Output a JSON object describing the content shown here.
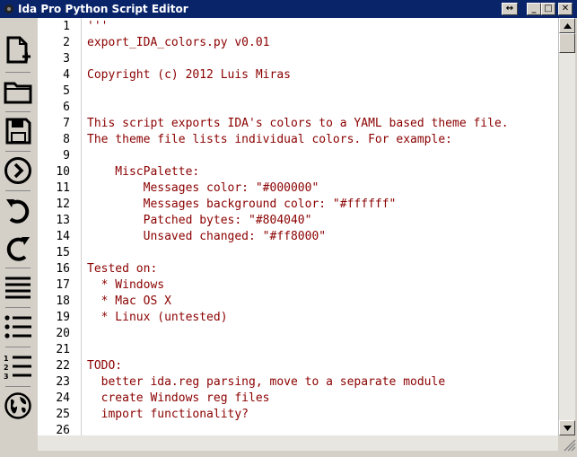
{
  "window": {
    "title": "Ida Pro Python Script Editor"
  },
  "title_buttons": [
    {
      "name": "resize-arrows-button",
      "glyph": "↔"
    },
    {
      "name": "minimize-button",
      "glyph": "_"
    },
    {
      "name": "maximize-button",
      "glyph": "□"
    },
    {
      "name": "close-button",
      "glyph": "✕"
    }
  ],
  "toolbar": {
    "tools": [
      {
        "name": "new-file-button",
        "icon": "new-file-icon"
      },
      {
        "name": "open-folder-button",
        "icon": "folder-icon"
      },
      {
        "name": "save-button",
        "icon": "save-icon"
      },
      {
        "name": "run-button",
        "icon": "run-circle-chevron-icon"
      },
      {
        "name": "undo-button",
        "icon": "undo-icon"
      },
      {
        "name": "redo-button",
        "icon": "redo-icon"
      },
      {
        "name": "align-button",
        "icon": "align-lines-icon"
      },
      {
        "name": "bullet-list-button",
        "icon": "bullet-list-icon"
      },
      {
        "name": "numbered-list-button",
        "icon": "numbered-list-icon"
      },
      {
        "name": "globe-button",
        "icon": "globe-icon"
      }
    ]
  },
  "editor": {
    "lines": [
      {
        "n": "1",
        "text": "'''"
      },
      {
        "n": "2",
        "text": "export_IDA_colors.py v0.01"
      },
      {
        "n": "3",
        "text": ""
      },
      {
        "n": "4",
        "text": "Copyright (c) 2012 Luis Miras"
      },
      {
        "n": "5",
        "text": ""
      },
      {
        "n": "6",
        "text": ""
      },
      {
        "n": "7",
        "text": "This script exports IDA's colors to a YAML based theme file."
      },
      {
        "n": "8",
        "text": "The theme file lists individual colors. For example:"
      },
      {
        "n": "9",
        "text": ""
      },
      {
        "n": "10",
        "text": "    MiscPalette:"
      },
      {
        "n": "11",
        "text": "        Messages color: \"#000000\""
      },
      {
        "n": "12",
        "text": "        Messages background color: \"#ffffff\""
      },
      {
        "n": "13",
        "text": "        Patched bytes: \"#804040\""
      },
      {
        "n": "14",
        "text": "        Unsaved changed: \"#ff8000\""
      },
      {
        "n": "15",
        "text": ""
      },
      {
        "n": "16",
        "text": "Tested on:"
      },
      {
        "n": "17",
        "text": "  * Windows"
      },
      {
        "n": "18",
        "text": "  * Mac OS X"
      },
      {
        "n": "19",
        "text": "  * Linux (untested)"
      },
      {
        "n": "20",
        "text": ""
      },
      {
        "n": "21",
        "text": ""
      },
      {
        "n": "22",
        "text": "TODO:"
      },
      {
        "n": "23",
        "text": "  better ida.reg parsing, move to a separate module"
      },
      {
        "n": "24",
        "text": "  create Windows reg files"
      },
      {
        "n": "25",
        "text": "  import functionality?"
      },
      {
        "n": "26",
        "text": ""
      }
    ]
  },
  "colors": {
    "titlebar": "#0a246a",
    "code_text": "#8b0000",
    "line_numbers": "#000000",
    "editor_bg": "#ffffff",
    "chrome": "#d4d0c8"
  }
}
